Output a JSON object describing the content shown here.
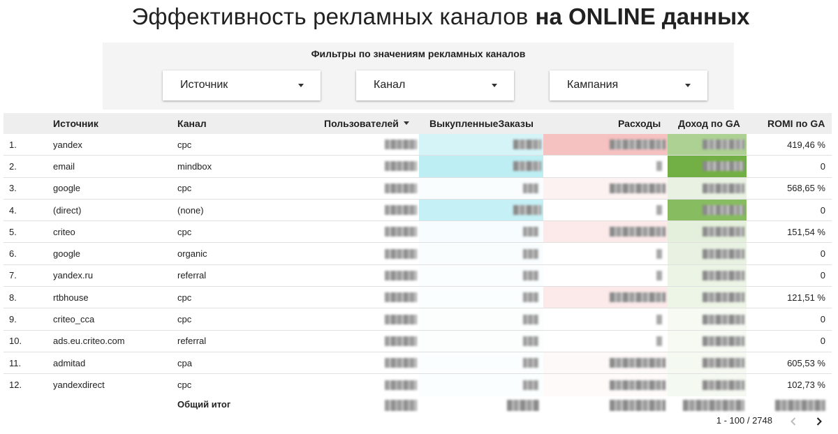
{
  "title": {
    "part1": "Эффективность рекламных каналов",
    "part2": "на ONLINE данных"
  },
  "filters": {
    "heading": "Фильтры по значениям рекламных каналов",
    "dropdowns": [
      {
        "label": "Источник"
      },
      {
        "label": "Канал"
      },
      {
        "label": "Кампания"
      }
    ]
  },
  "table": {
    "headers": {
      "source": "Источник",
      "channel": "Канал",
      "users": "Пользователей",
      "orders": "ВыкупленныеЗаказы",
      "cost": "Расходы",
      "revenue": "Доход по GA",
      "romi": "ROMI по GA"
    },
    "rows": [
      {
        "num": "1.",
        "source": "yandex",
        "channel": "cpc",
        "romi": "419,46 %"
      },
      {
        "num": "2.",
        "source": "email",
        "channel": "mindbox",
        "romi": "0"
      },
      {
        "num": "3.",
        "source": "google",
        "channel": "cpc",
        "romi": "568,65 %"
      },
      {
        "num": "4.",
        "source": "(direct)",
        "channel": "(none)",
        "romi": "0"
      },
      {
        "num": "5.",
        "source": "criteo",
        "channel": "cpc",
        "romi": "151,54 %"
      },
      {
        "num": "6.",
        "source": "google",
        "channel": "organic",
        "romi": "0"
      },
      {
        "num": "7.",
        "source": "yandex.ru",
        "channel": "referral",
        "romi": "0"
      },
      {
        "num": "8.",
        "source": "rtbhouse",
        "channel": "cpc",
        "romi": "121,51 %"
      },
      {
        "num": "9.",
        "source": "criteo_cca",
        "channel": "cpc",
        "romi": "0"
      },
      {
        "num": "10.",
        "source": "ads.eu.criteo.com",
        "channel": "referral",
        "romi": "0"
      },
      {
        "num": "11.",
        "source": "admitad",
        "channel": "cpa",
        "romi": "605,53 %"
      },
      {
        "num": "12.",
        "source": "yandexdirect",
        "channel": "cpc",
        "romi": "102,73 %"
      }
    ],
    "total_label": "Общий итог"
  },
  "pagination": {
    "range": "1 - 100 / 2748"
  },
  "colors": {
    "orders_heat": "#b2ebf2",
    "cost_heat": "#f4b6b6",
    "revenue_heat": "#6aab3a",
    "header_bg": "#eeeeee",
    "filter_bg": "#f4f4f4"
  },
  "heat": {
    "orders": [
      0.55,
      0.85,
      0.08,
      0.75,
      0.1,
      0.08,
      0.06,
      0.07,
      0.04,
      0.04,
      0.05,
      0.05
    ],
    "cost": [
      0.85,
      0.0,
      0.18,
      0.0,
      0.3,
      0.0,
      0.0,
      0.3,
      0.0,
      0.0,
      0.08,
      0.07
    ],
    "revenue": [
      0.55,
      0.95,
      0.15,
      0.8,
      0.18,
      0.15,
      0.13,
      0.12,
      0.06,
      0.06,
      0.07,
      0.07
    ]
  },
  "icons": {
    "prev": "chevron-left-icon",
    "next": "chevron-right-icon",
    "sort": "sort-desc-icon",
    "dropdown": "caret-down-icon"
  }
}
